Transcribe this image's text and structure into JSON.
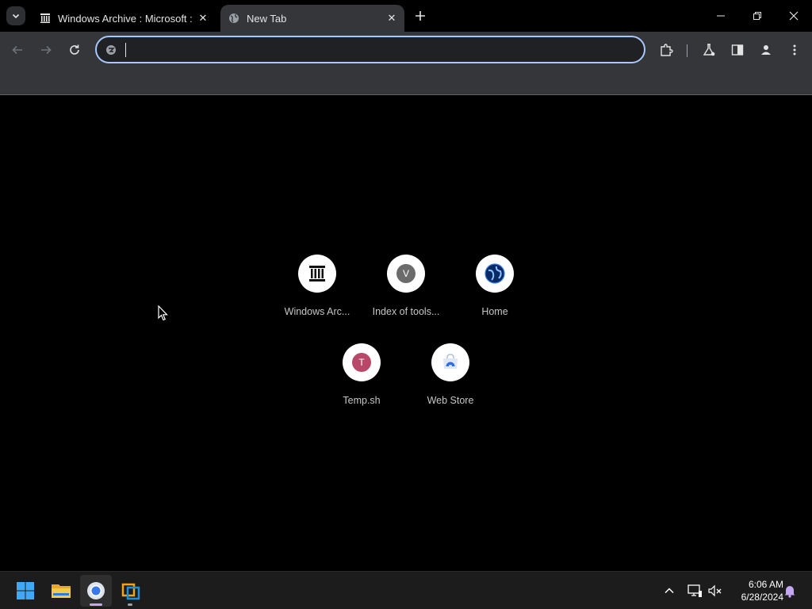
{
  "browser": {
    "tabs": [
      {
        "title": "Windows Archive : Microsoft : ",
        "favicon": "archive-icon",
        "active": false
      },
      {
        "title": "New Tab",
        "favicon": "globe-icon",
        "active": true
      }
    ],
    "omnibox": {
      "value": "",
      "placeholder": ""
    }
  },
  "ntp": {
    "shortcuts": [
      {
        "label": "Windows Arc...",
        "icon": "archive-icon"
      },
      {
        "label": "Index of tools...",
        "icon": "letter-icon",
        "letter": "V",
        "color": "#6b6b6b"
      },
      {
        "label": "Home",
        "icon": "globe-blue-icon"
      },
      {
        "label": "Temp.sh",
        "icon": "letter-icon",
        "letter": "T",
        "color": "#b8476a"
      },
      {
        "label": "Web Store",
        "icon": "webstore-icon"
      }
    ]
  },
  "taskbar": {
    "time": "6:06 AM",
    "date": "6/28/2024"
  },
  "colors": {
    "accent": "#a8c7fa",
    "toolbar": "#35363a",
    "taskbar": "#1c1c1c"
  }
}
